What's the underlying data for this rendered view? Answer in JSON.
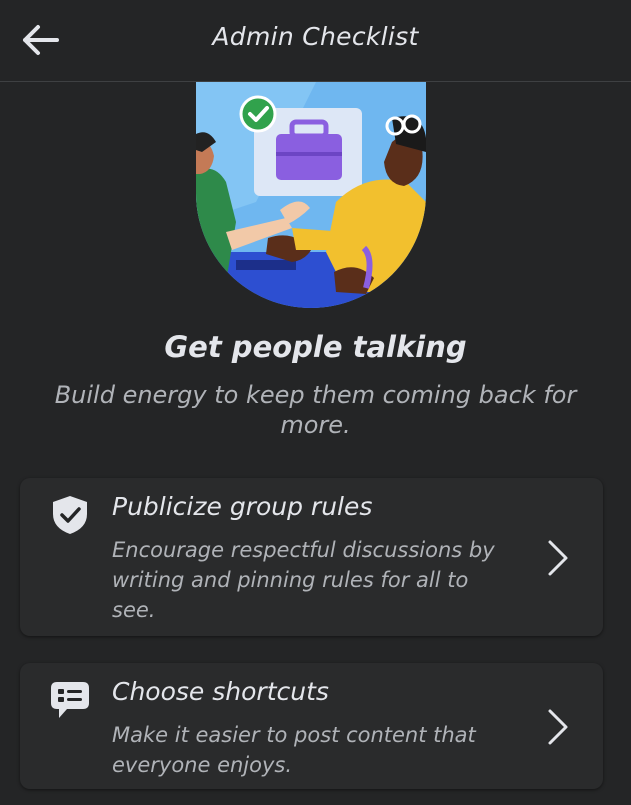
{
  "header": {
    "title": "Admin Checklist",
    "back_icon": "arrow-left-icon"
  },
  "hero": {
    "image": "people-shaking-hands-illustration",
    "badge_icon": "check-circle-icon"
  },
  "section": {
    "heading": "Get people talking",
    "subheading": "Build energy to keep them coming back for more."
  },
  "checklist": [
    {
      "icon": "shield-check-icon",
      "title": "Publicize group rules",
      "description": "Encourage respectful discussions by writing and pinning rules for all to see.",
      "chevron_icon": "chevron-right-icon"
    },
    {
      "icon": "speech-bubble-icon",
      "title": "Choose shortcuts",
      "description": "Make it easier to post content that everyone enjoys.",
      "chevron_icon": "chevron-right-icon"
    }
  ],
  "colors": {
    "background": "#242526",
    "card": "#2a2b2c",
    "primary_text": "#e4e6eb",
    "secondary_text": "#b0b3b8",
    "check_green": "#31a24c"
  }
}
